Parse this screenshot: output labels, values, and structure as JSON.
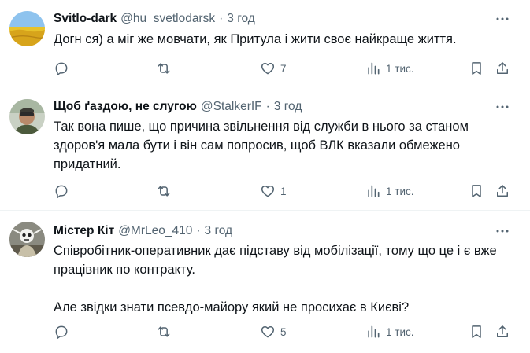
{
  "posts": [
    {
      "author_name": "Svitlo-dark",
      "author_handle": "@hu_svetlodarsk",
      "separator": "·",
      "time": "3 год",
      "text": [
        "Догн   ся) а міг же мовчати, як Притула і жити своє найкраще життя."
      ],
      "replies": "",
      "reposts": "",
      "likes": "7",
      "views": "1 тис."
    },
    {
      "author_name": "Щоб ґаздою, не слугою",
      "author_handle": "@StalkerIF",
      "separator": "·",
      "time": "3 год",
      "text": [
        "Так вона пише, що причина звільнення від служби в нього за станом здоров'я мала бути і він сам попросив, щоб ВЛК вказали обмежено придатний."
      ],
      "replies": "",
      "reposts": "",
      "likes": "1",
      "views": "1 тис."
    },
    {
      "author_name": "Містер Кіт",
      "author_handle": "@MrLeo_410",
      "separator": "·",
      "time": "3 год",
      "text": [
        "Співробітник-оперативник дає підставу від мобілізації, тому що це і є вже працівник по контракту.",
        "Але звідки знати псевдо-майору який не просихає в Києві?"
      ],
      "replies": "",
      "reposts": "",
      "likes": "5",
      "views": "1 тис."
    }
  ],
  "icons": {
    "more": "more-horizontal-icon",
    "reply": "reply-icon",
    "repost": "repost-icon",
    "like": "like-heart-icon",
    "views": "views-bar-chart-icon",
    "bookmark": "bookmark-icon",
    "share": "share-icon"
  },
  "colors": {
    "text": "#0f1419",
    "secondary": "#536471",
    "divider": "#eff3f4"
  }
}
